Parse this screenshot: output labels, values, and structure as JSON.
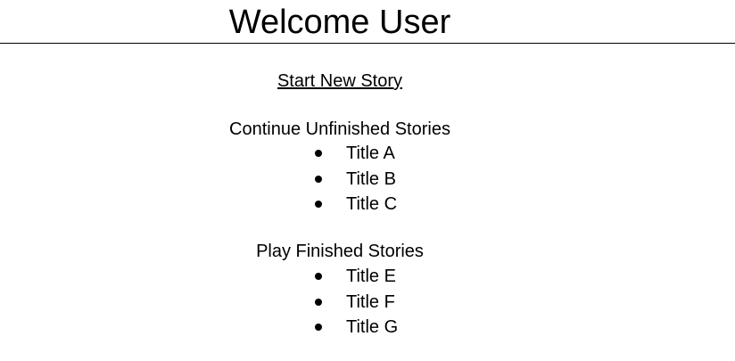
{
  "header": {
    "title": "Welcome User"
  },
  "actions": {
    "start_new_story": "Start New Story"
  },
  "unfinished": {
    "heading": "Continue Unfinished Stories",
    "items": [
      {
        "label": "Title A"
      },
      {
        "label": "Title B"
      },
      {
        "label": "Title C"
      }
    ]
  },
  "finished": {
    "heading": "Play Finished Stories",
    "items": [
      {
        "label": "Title E"
      },
      {
        "label": "Title F"
      },
      {
        "label": "Title G"
      }
    ]
  }
}
